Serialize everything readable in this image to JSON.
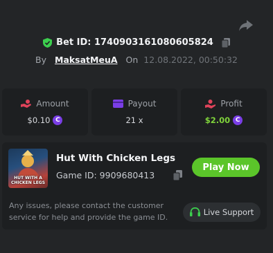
{
  "header": {
    "bet_id_label": "Bet ID: 1740903161080605824",
    "by_label": "By",
    "username": "MaksatMeuA",
    "on_label": "On",
    "date": "12.08.2022, 00:50:32"
  },
  "stats": [
    {
      "label": "Amount",
      "value": "$0.10",
      "icon": "coins-hand-icon",
      "icon_color": "#e0435a"
    },
    {
      "label": "Payout",
      "value": "21 x",
      "icon": "wallet-card-icon",
      "icon_color": "#7a3ee6"
    },
    {
      "label": "Profit",
      "value": "$2.00",
      "icon": "hand-money-icon",
      "icon_color": "#e0435a",
      "value_color": "#7fd33b"
    }
  ],
  "currency_symbol": "C",
  "game": {
    "title": "Hut With Chicken Legs",
    "id_label": "Game ID: 9909680413",
    "thumb_text_top": "HUT WITH A",
    "thumb_text_bottom": "CHICKEN LEGS",
    "play_label": "Play Now"
  },
  "footer": {
    "issue_text": "Any issues, please contact the customer service for help and provide the game ID.",
    "support_label": "Live Support"
  },
  "colors": {
    "accent_green": "#5bc52a",
    "shield_green": "#3ccf4e",
    "coin_purple": "#7a3ee6",
    "background": "#232527",
    "panel": "#1d1f21"
  }
}
